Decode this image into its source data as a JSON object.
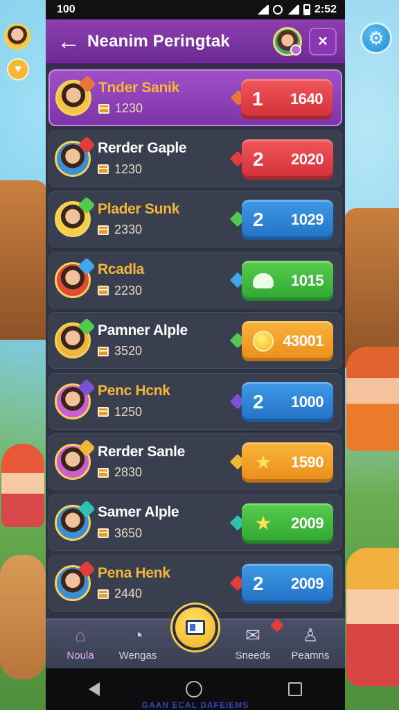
{
  "status_bar": {
    "left_text": "100",
    "time": "2:52"
  },
  "header": {
    "title": "Neanim Peringtak",
    "back_label": "←",
    "close_label": "×"
  },
  "rows": [
    {
      "name": "Tnder Sanik",
      "score": "1230",
      "rank": "1",
      "value": "1640",
      "pill_color": "red",
      "diamond_color": "#e8763a",
      "name_gold": true,
      "highlight": true,
      "avatar_bg": "#f3c34a"
    },
    {
      "name": "Rerder Gaple",
      "score": "1230",
      "rank": "2",
      "value": "2020",
      "pill_color": "red",
      "diamond_color": "#e23d3d",
      "name_gold": false,
      "highlight": false,
      "avatar_bg": "#3e8ed6"
    },
    {
      "name": "Plader Sunk",
      "score": "2330",
      "rank": "2",
      "value": "1029",
      "pill_color": "blue",
      "diamond_color": "#54c850",
      "name_gold": true,
      "highlight": false,
      "avatar_bg": "#f3d04a"
    },
    {
      "name": "Rcadla",
      "score": "2230",
      "rank": "",
      "value": "1015",
      "pill_color": "green",
      "diamond_color": "#3ea8ea",
      "name_gold": true,
      "highlight": false,
      "avatar_bg": "#e24a3a",
      "icon": "cloud"
    },
    {
      "name": "Pamner Alple",
      "score": "3520",
      "rank": "",
      "value": "43001",
      "pill_color": "orange",
      "diamond_color": "#54c850",
      "name_gold": false,
      "highlight": false,
      "avatar_bg": "#f0b53c",
      "icon": "coin"
    },
    {
      "name": "Penc Hcnk",
      "score": "1250",
      "rank": "2",
      "value": "1000",
      "pill_color": "blue",
      "diamond_color": "#7b52d6",
      "name_gold": true,
      "highlight": false,
      "avatar_bg": "#c95fd0"
    },
    {
      "name": "Rerder Sanle",
      "score": "2830",
      "rank": "",
      "value": "1590",
      "pill_color": "orange",
      "diamond_color": "#f0b83a",
      "name_gold": false,
      "highlight": false,
      "avatar_bg": "#c95fd0",
      "icon": "star"
    },
    {
      "name": "Samer Alple",
      "score": "3650",
      "rank": "",
      "value": "2009",
      "pill_color": "green",
      "diamond_color": "#2fc2b0",
      "name_gold": false,
      "highlight": false,
      "avatar_bg": "#3e8ed6",
      "icon": "star"
    },
    {
      "name": "Pena Henk",
      "score": "2440",
      "rank": "2",
      "value": "2009",
      "pill_color": "blue",
      "diamond_color": "#e23d3d",
      "name_gold": true,
      "highlight": false,
      "avatar_bg": "#3e8ed6"
    }
  ],
  "nav": {
    "items": [
      {
        "label": "Noula",
        "icon": "house-icon",
        "glyph": "⌂",
        "active": true
      },
      {
        "label": "Wengas",
        "icon": "bird-icon",
        "glyph": "◔",
        "active": false
      },
      {
        "label": "",
        "icon": "card-icon",
        "glyph": "",
        "active": false
      },
      {
        "label": "Sneeds",
        "icon": "mail-icon",
        "glyph": "✉",
        "active": false
      },
      {
        "label": "Peamns",
        "icon": "person-icon",
        "glyph": "♙",
        "active": false
      }
    ]
  },
  "footer_text": "GAAN ECAL DAFEIEMS",
  "colors": {
    "header": "#7b32a2",
    "panel": "#2f3342",
    "gold": "#f6b63a"
  }
}
